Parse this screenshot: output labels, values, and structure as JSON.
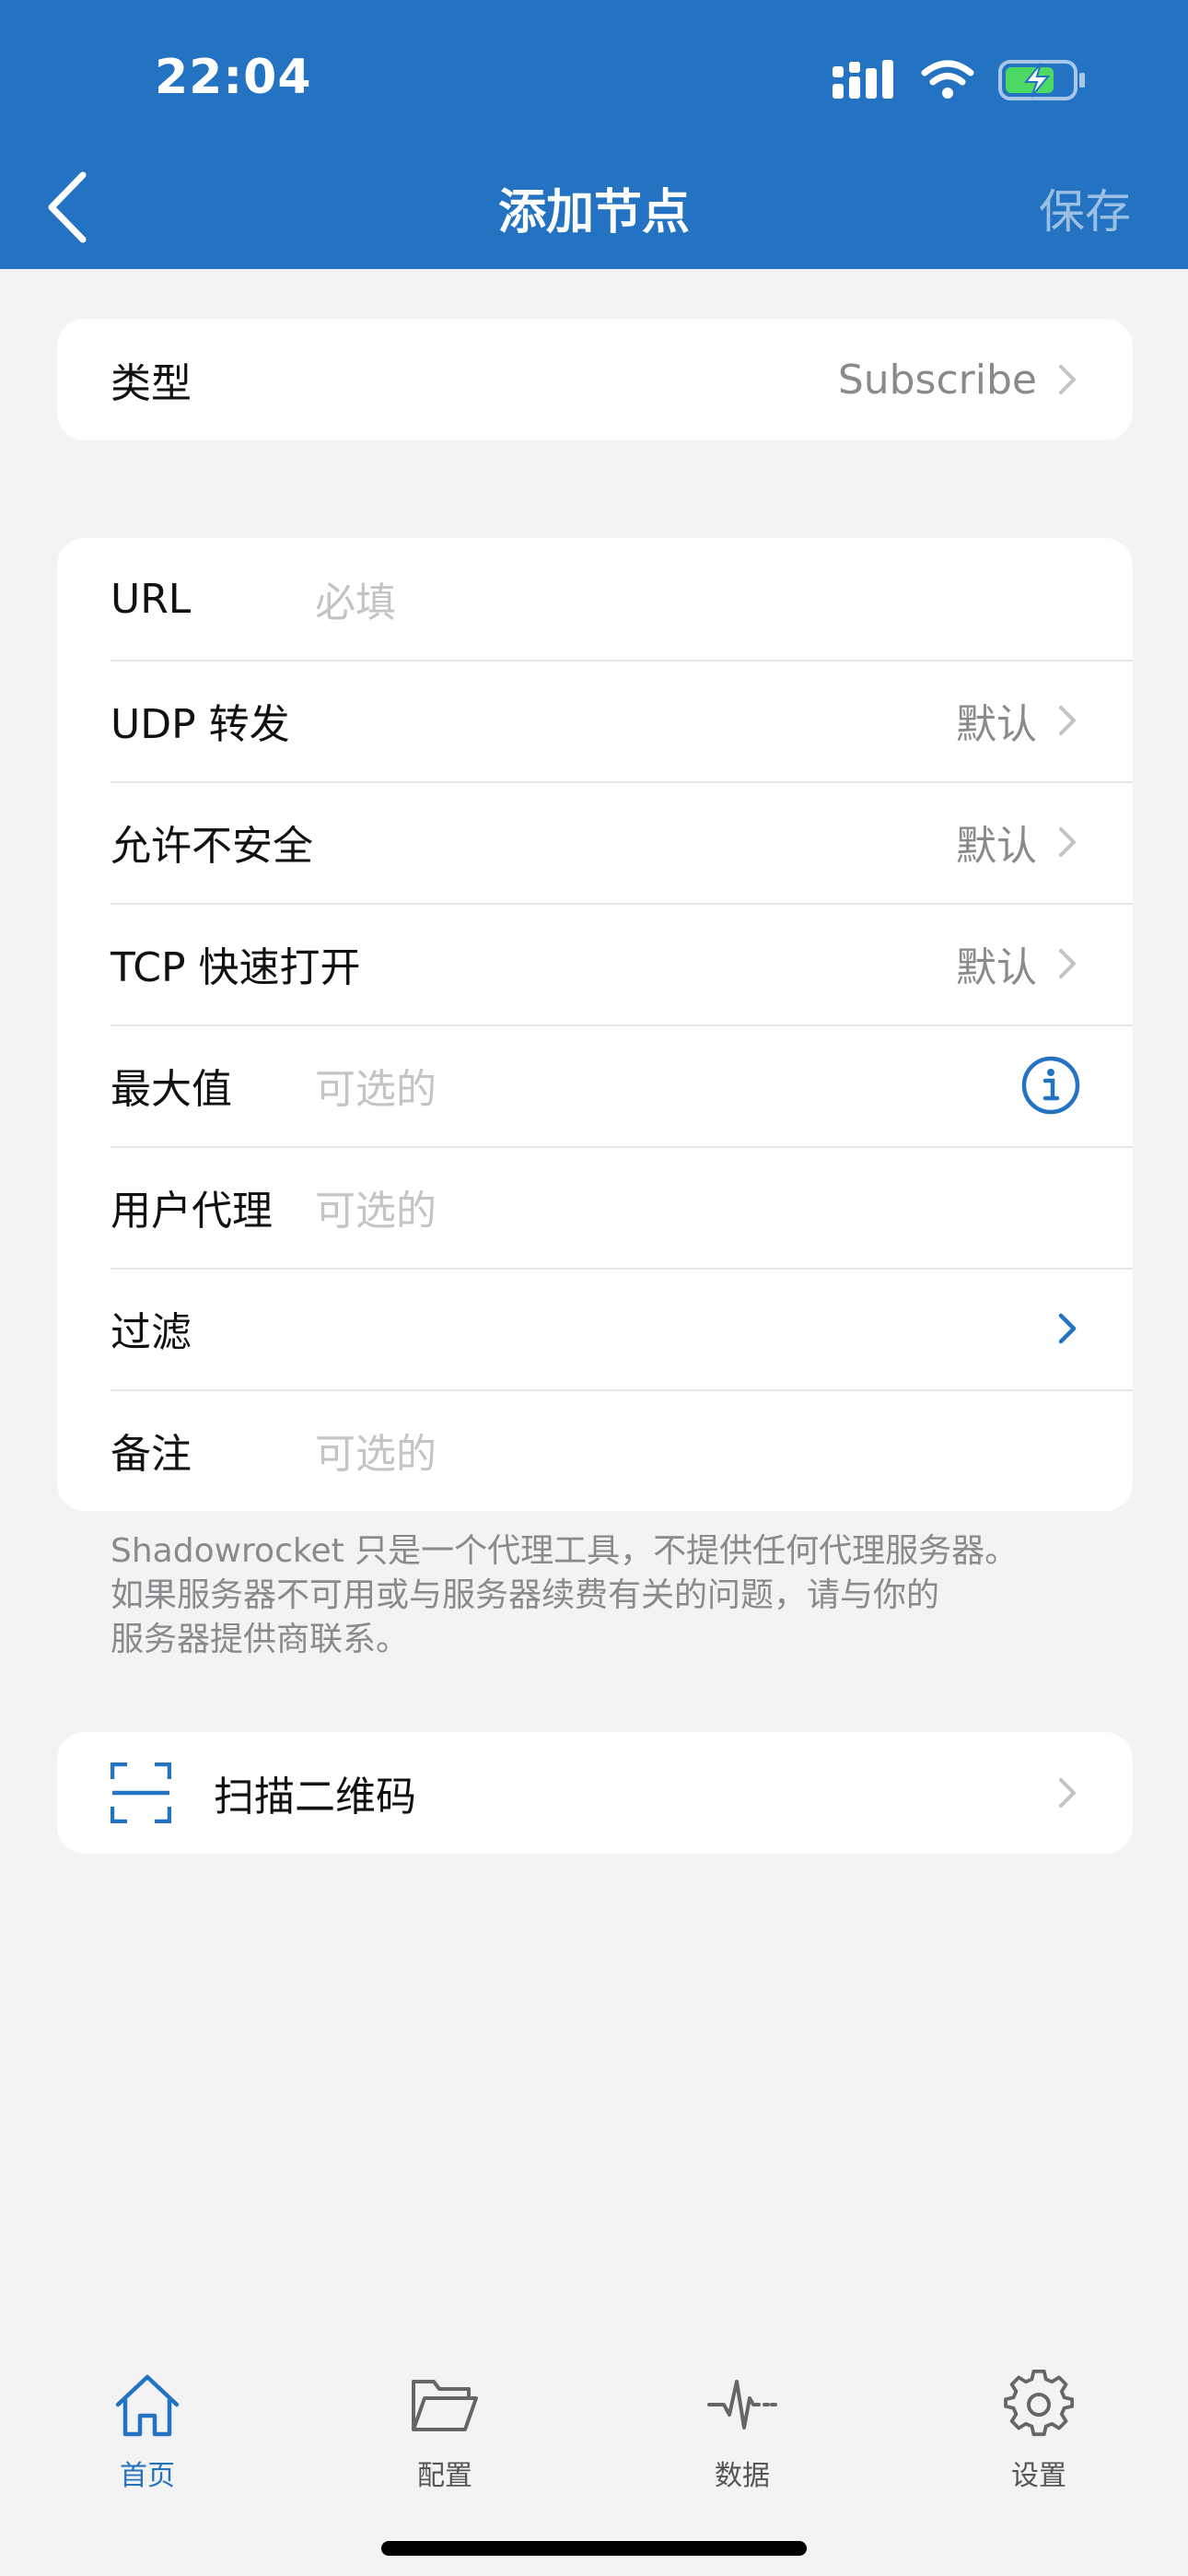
{
  "status": {
    "time": "22:04"
  },
  "nav": {
    "back_icon": "chevron-left-icon",
    "title": "添加节点",
    "save_label": "保存"
  },
  "type_card": {
    "label": "类型",
    "value": "Subscribe"
  },
  "form": {
    "url": {
      "label": "URL",
      "placeholder": "必填"
    },
    "udp": {
      "label": "UDP 转发",
      "value": "默认"
    },
    "insecure": {
      "label": "允许不安全",
      "value": "默认"
    },
    "tfo": {
      "label": "TCP 快速打开",
      "value": "默认"
    },
    "max": {
      "label": "最大值",
      "placeholder": "可选的"
    },
    "ua": {
      "label": "用户代理",
      "placeholder": "可选的"
    },
    "filter": {
      "label": "过滤"
    },
    "note": {
      "label": "备注",
      "placeholder": "可选的"
    }
  },
  "footnote": {
    "line1": "Shadowrocket 只是一个代理工具，不提供任何代理服务器。",
    "line2": "如果服务器不可用或与服务器续费有关的问题，请与你的",
    "line3": "服务器提供商联系。"
  },
  "scan": {
    "label": "扫描二维码"
  },
  "tabs": [
    {
      "label": "首页",
      "icon": "home-icon",
      "active": true
    },
    {
      "label": "配置",
      "icon": "folder-icon",
      "active": false
    },
    {
      "label": "数据",
      "icon": "activity-icon",
      "active": false
    },
    {
      "label": "设置",
      "icon": "gear-icon",
      "active": false
    }
  ],
  "colors": {
    "accent": "#2473c2",
    "background": "#f3f3f3",
    "battery_fill": "#4cd964"
  }
}
